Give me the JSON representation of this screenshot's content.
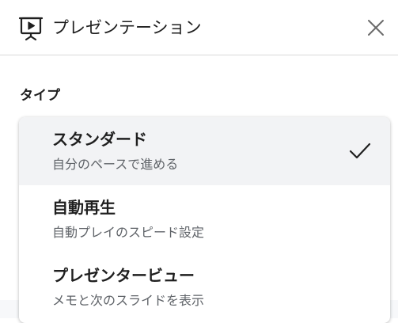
{
  "dialog": {
    "title": "プレゼンテーション",
    "header_icon": "presentation-screen-icon",
    "close_icon": "close-icon"
  },
  "type_section": {
    "label": "タイプ",
    "options": [
      {
        "title": "スタンダード",
        "description": "自分のペースで進める",
        "selected": true
      },
      {
        "title": "自動再生",
        "description": "自動プレイのスピード設定",
        "selected": false
      },
      {
        "title": "プレゼンタービュー",
        "description": "メモと次のスライドを表示",
        "selected": false
      }
    ],
    "selected_icon": "checkmark-icon"
  },
  "colors": {
    "text_primary": "#1f1f1f",
    "text_secondary": "#5f6368",
    "selected_background": "#f2f3f5",
    "divider": "#d9d9d9"
  }
}
